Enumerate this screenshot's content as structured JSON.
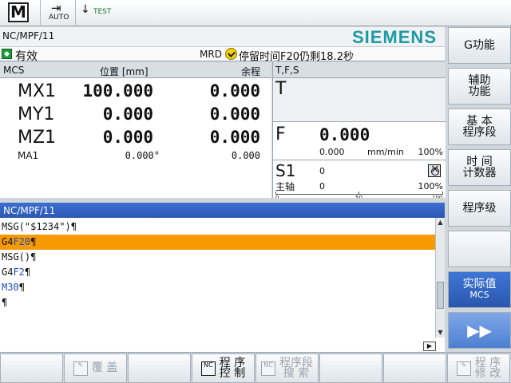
{
  "top": {
    "mode_icon": "M",
    "auto_label": "AUTO",
    "test_label": "TEST"
  },
  "header": {
    "program_path": "NC/MPF/11",
    "brand": "SIEMENS"
  },
  "status": {
    "channel_state": "有效",
    "mrd": "MRD",
    "message": "停留时间F20仍剩18.2秒",
    "icon": "check-circle-icon",
    "ok_color": "#1d9b3b"
  },
  "positions": {
    "headers": {
      "axis": "MCS",
      "pos": "位置 [mm]",
      "dtg": "余程"
    },
    "axes": [
      {
        "name": "MX1",
        "pos": "100.000",
        "dtg": "0.000"
      },
      {
        "name": "MY1",
        "pos": "0.000",
        "dtg": "0.000"
      },
      {
        "name": "MZ1",
        "pos": "0.000",
        "dtg": "0.000"
      },
      {
        "name": "MA1",
        "pos": "0.000°",
        "dtg": "0.000"
      }
    ]
  },
  "tfs": {
    "header": "T,F,S",
    "t_label": "T",
    "f_label": "F",
    "f_value": "0.000",
    "f_actual": "0.000",
    "f_unit": "mm/min",
    "f_override": "100%",
    "s_label": "S1",
    "s_value": "0",
    "spindle_label": "主轴",
    "spindle_actual": "0",
    "spindle_override": "100%",
    "scale": [
      "0",
      "50",
      "100"
    ]
  },
  "editor": {
    "title": "NC/MPF/11",
    "lines": [
      {
        "text": "MSG(\"$1234\")¶"
      },
      {
        "prefix": "G4",
        "kw": "F20",
        "suffix": "¶"
      },
      {
        "text": "MSG()¶"
      },
      {
        "prefix": "G4",
        "kw": "F2",
        "suffix": "¶"
      },
      {
        "prefix": "",
        "kw": "M30",
        "suffix": "¶"
      },
      {
        "text": "¶"
      }
    ],
    "highlight_color": "#f79a00"
  },
  "right_softkeys": [
    {
      "label": "G功能"
    },
    {
      "label": "辅助\n功能"
    },
    {
      "label": "基 本\n程序段"
    },
    {
      "label": "时 间\n计数器"
    },
    {
      "label": "程序级"
    },
    {
      "label": ""
    },
    {
      "label": "实际值",
      "sub": "MCS"
    },
    {
      "label": "▶▶"
    }
  ],
  "bottom_softkeys": [
    {
      "label": ""
    },
    {
      "label": "覆 盖",
      "icon": "edit-icon"
    },
    {
      "label": ""
    },
    {
      "label": "程 序\n控 制",
      "icon": "nc-program-icon"
    },
    {
      "label": "程序段\n搜 索",
      "icon": "nc-search-icon"
    },
    {
      "label": ""
    },
    {
      "label": ""
    },
    {
      "label": "程 序\n修 改",
      "icon": "edit-icon"
    }
  ]
}
